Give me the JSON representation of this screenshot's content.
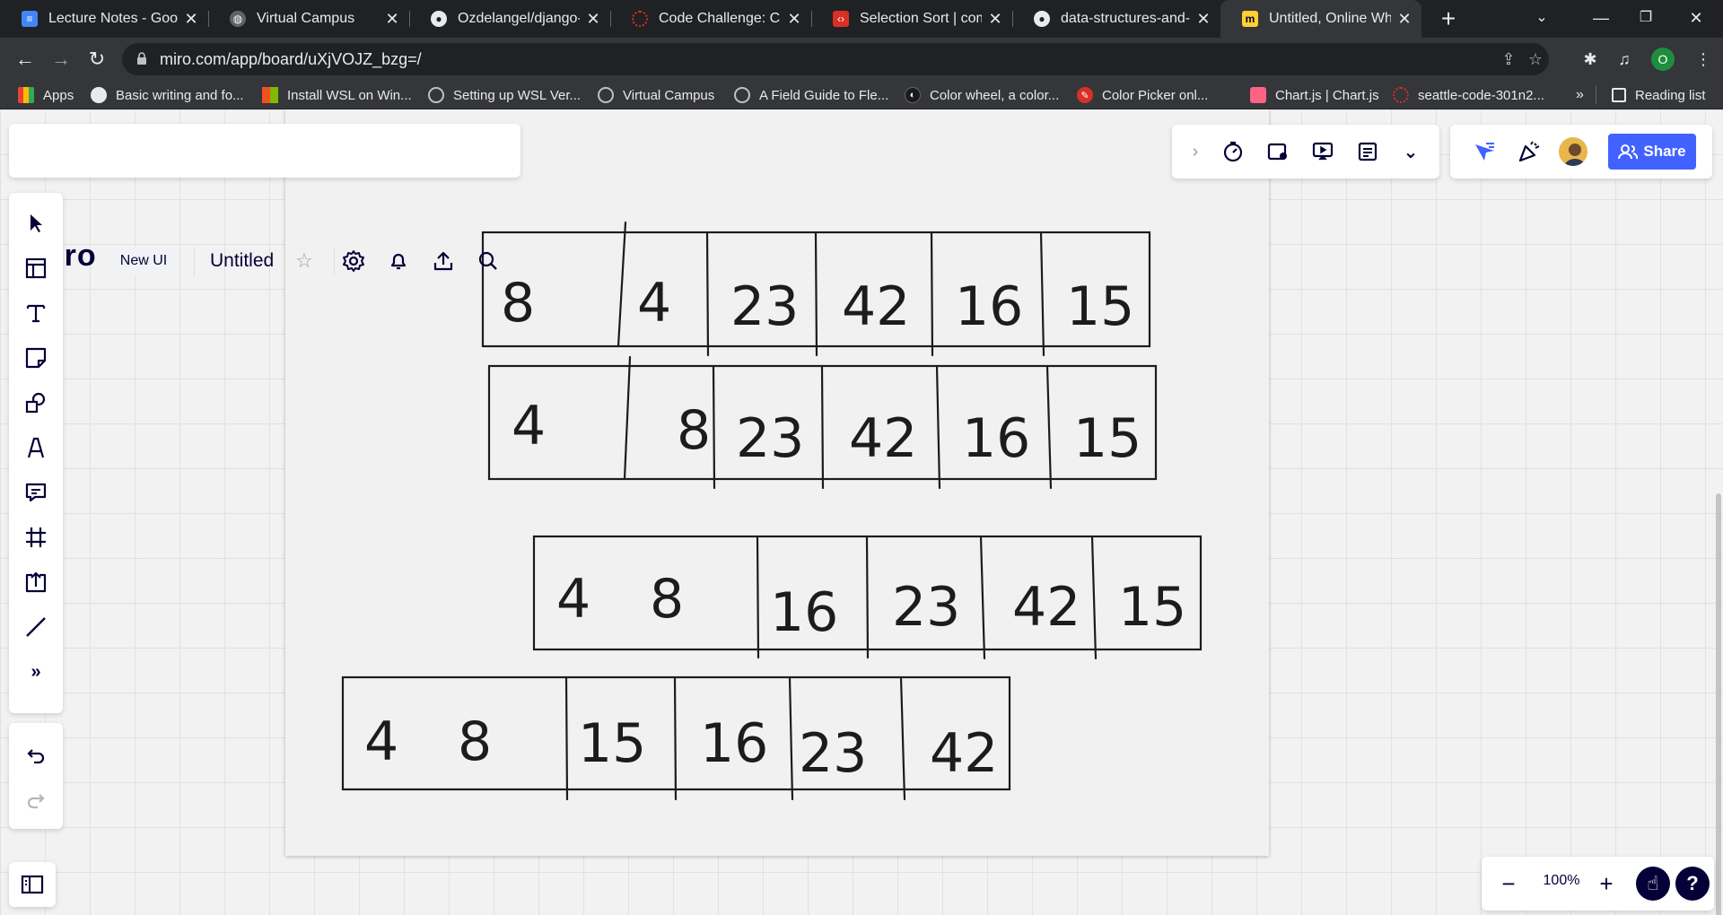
{
  "browser": {
    "tabs": [
      {
        "title": "Lecture Notes - Goog",
        "icon": "google-docs-icon",
        "color": "#4285f4"
      },
      {
        "title": "Virtual Campus",
        "icon": "globe-icon",
        "color": "#9aa0a6"
      },
      {
        "title": "Ozdelangel/django-p",
        "icon": "github-icon",
        "color": "#e8eaed"
      },
      {
        "title": "Code Challenge: Class",
        "icon": "codefellows-icon",
        "color": "#d93025"
      },
      {
        "title": "Selection Sort | comm",
        "icon": "codefellows-shield-icon",
        "color": "#d93025"
      },
      {
        "title": "data-structures-and-a",
        "icon": "github-icon",
        "color": "#e8eaed"
      },
      {
        "title": "Untitled, Online White",
        "icon": "miro-icon",
        "color": "#ffd02f",
        "active": true
      }
    ],
    "url": "miro.com/app/board/uXjVOJZ_bzg=/",
    "profile_initial": "O",
    "bookmarks": [
      {
        "label": "Apps",
        "icon": "apps-grid-icon",
        "color": "#4285f4"
      },
      {
        "label": "Basic writing and fo...",
        "icon": "github-icon",
        "color": "#202124"
      },
      {
        "label": "Install WSL on Win...",
        "icon": "microsoft-icon",
        "color": "#f25022"
      },
      {
        "label": "Setting up WSL Ver...",
        "icon": "globe-icon",
        "color": "#9aa0a6"
      },
      {
        "label": "Virtual Campus",
        "icon": "globe-icon",
        "color": "#9aa0a6"
      },
      {
        "label": "A Field Guide to Fle...",
        "icon": "globe-icon",
        "color": "#9aa0a6"
      },
      {
        "label": "Color wheel, a color...",
        "icon": "color-wheel-icon",
        "color": "#1a1a1a"
      },
      {
        "label": "Color Picker onl...",
        "icon": "color-picker-icon",
        "color": "#d93025"
      },
      {
        "label": "Chart.js | Chart.js",
        "icon": "chartjs-icon",
        "color": "#ff6384"
      },
      {
        "label": "seattle-code-301n2...",
        "icon": "codefellows-icon",
        "color": "#d93025"
      }
    ],
    "reading_list": "Reading list",
    "more_bookmarks": "»"
  },
  "miro": {
    "logo": "miro",
    "new_ui": "New UI",
    "board_name": "Untitled",
    "share": "Share",
    "zoom": "100%",
    "help": "?"
  },
  "board": {
    "rows": [
      [
        "8",
        "4",
        "23",
        "42",
        "16",
        "15"
      ],
      [
        "4",
        "8",
        "23",
        "42",
        "16",
        "15"
      ],
      [
        "4",
        "8",
        "16",
        "23",
        "42",
        "15"
      ],
      [
        "4",
        "8",
        "15",
        "16",
        "23",
        "42"
      ]
    ]
  },
  "colors": {
    "miro_blue": "#4262ff",
    "miro_dark": "#050038",
    "chrome_dark": "#202124",
    "chrome_toolbar": "#35363a"
  }
}
